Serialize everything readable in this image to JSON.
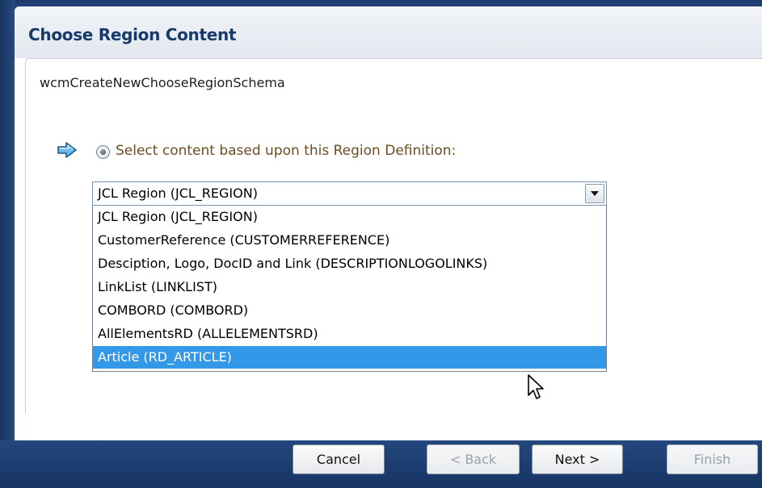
{
  "dialog": {
    "title": "Choose Region Content",
    "schema_label": "wcmCreateNewChooseRegionSchema"
  },
  "region_option": {
    "radio_selected": true,
    "label": "Select content based upon this Region Definition:"
  },
  "region_select": {
    "selected_value": "JCL Region (JCL_REGION)",
    "options": [
      "JCL Region (JCL_REGION)",
      "CustomerReference (CUSTOMERREFERENCE)",
      "Desciption, Logo, DocID and Link (DESCRIPTIONLOGOLINKS)",
      "LinkList (LINKLIST)",
      "COMBORD (COMBORD)",
      "AllElementsRD (ALLELEMENTSRD)",
      "Article (RD_ARTICLE)"
    ],
    "highlighted_index": 6
  },
  "buttons": {
    "cancel": "Cancel",
    "back": "< Back",
    "next": "Next >",
    "finish": "Finish"
  },
  "colors": {
    "highlight": "#3498e8",
    "title_text": "#173a6a",
    "frame": "#1d3a6e"
  },
  "icons": {
    "step_indicator": "right-arrow-icon",
    "dropdown": "chevron-down-icon",
    "pointer": "mouse-cursor-icon"
  }
}
